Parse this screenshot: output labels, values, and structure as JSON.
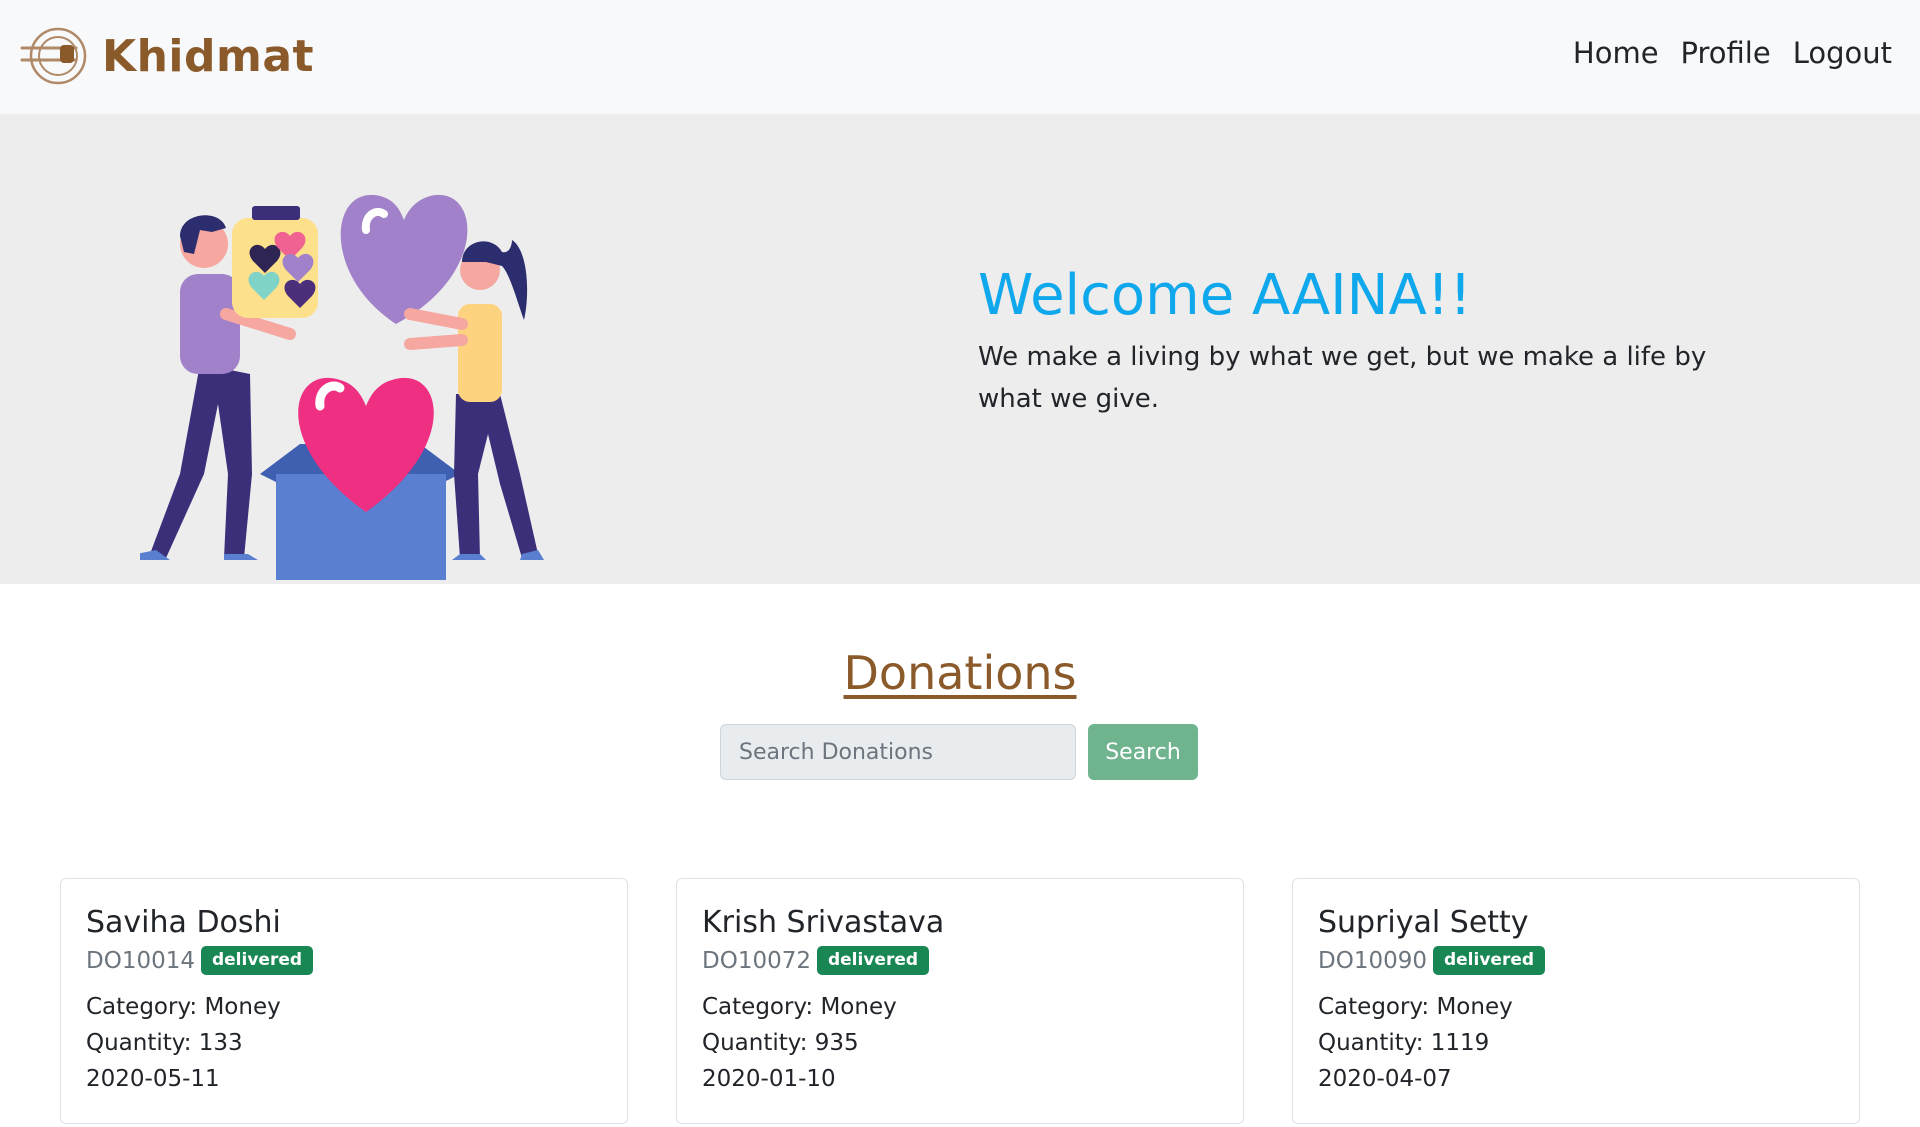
{
  "navbar": {
    "brand": "Khidmat",
    "links": [
      "Home",
      "Profile",
      "Logout"
    ]
  },
  "hero": {
    "title": "Welcome AAINA!!",
    "quote": "We make a living by what we get, but we make a life by what we give."
  },
  "donations": {
    "heading": "Donations",
    "search_placeholder": "Search Donations",
    "search_button": "Search",
    "cards": [
      {
        "name": "Saviha Doshi",
        "id": "DO10014",
        "status": "delivered",
        "category": "Category: Money",
        "quantity": "Quantity: 133",
        "date": "2020-05-11"
      },
      {
        "name": "Krish Srivastava",
        "id": "DO10072",
        "status": "delivered",
        "category": "Category: Money",
        "quantity": "Quantity: 935",
        "date": "2020-01-10"
      },
      {
        "name": "Supriyal Setty",
        "id": "DO10090",
        "status": "delivered",
        "category": "Category: Money",
        "quantity": "Quantity: 1119",
        "date": "2020-04-07"
      }
    ]
  },
  "colors": {
    "brand": "#8b5a2b",
    "welcome": "#10a8ec",
    "search_button": "#6fb48f",
    "badge": "#198754",
    "navbar_bg": "#f8f9fa",
    "hero_bg": "#ededed"
  }
}
